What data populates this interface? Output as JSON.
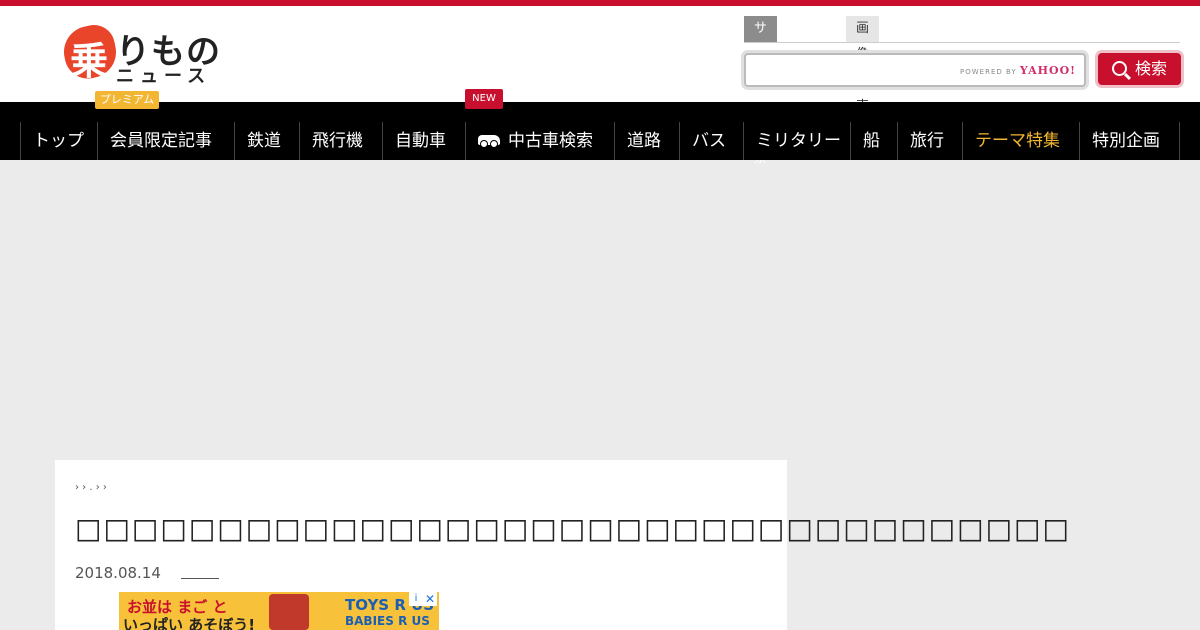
{
  "header": {
    "logo": {
      "kanji": "乗",
      "main": "りもの",
      "sub": "ニュース"
    },
    "search": {
      "tabs": [
        "サイト内検索",
        "画像検索"
      ],
      "placeholder": "",
      "powered_by": "POWERED BY",
      "provider": "YAHOO!",
      "button_label": "検索"
    }
  },
  "nav": {
    "items": [
      "トップ",
      "会員限定記事",
      "鉄道",
      "飛行機",
      "自動車",
      "中古車検索",
      "道路",
      "バス",
      "ミリタリー",
      "船",
      "旅行",
      "テーマ特集",
      "特別企画"
    ],
    "premium_badge": "プレミアム",
    "new_badge": "NEW"
  },
  "article": {
    "breadcrumb": "› › . › ›",
    "title": "□□□□□□□□□□□□□□□□□□□□□□□□□□□□□□□□□□□",
    "date": "2018.08.14"
  },
  "ad": {
    "line1": "お並は まご と",
    "line2": "いっぱい あそぼう!",
    "brand1": "TOYS R US",
    "brand2": "BABIES R US",
    "close": "✕",
    "info": "i"
  },
  "colors": {
    "brand_red": "#c8102e",
    "theme_gold": "#f2b632",
    "nav_bg": "#000000"
  }
}
